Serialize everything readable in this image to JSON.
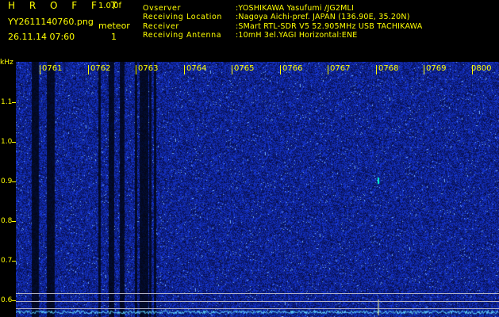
{
  "header": {
    "app_title": "H R O F F T",
    "version": "1.0.0f",
    "filename": "YY2611140760.png",
    "mode": "meteor",
    "timestamp": "26.11.14 07:60",
    "count": "1"
  },
  "info": [
    {
      "label": "Ovserver",
      "value": ":YOSHIKAWA Yasufumi /JG2MLI"
    },
    {
      "label": "Receiving Location",
      "value": ":Nagoya Aichi-pref. JAPAN (136.90E, 35.20N)"
    },
    {
      "label": "Receiver",
      "value": ":SMart RTL-SDR V5 52.905MHz USB TACHIKAWA"
    },
    {
      "label": "Receiving Antenna",
      "value": ":10mH 3el.YAGI Horizontal:ENE"
    }
  ],
  "axes": {
    "y_unit": "kHz",
    "y_ticks": [
      "1.1",
      "1.0",
      "0.9",
      "0.8",
      "0.7",
      "0.6"
    ],
    "x_ticks": [
      "0761",
      "0762",
      "0763",
      "0764",
      "0765",
      "0766",
      "0767",
      "0768",
      "0769",
      "0800"
    ]
  },
  "colors": {
    "text": "#ffff00",
    "background": "#000000",
    "noise": "#1a22c0",
    "signal": "#00e5ff",
    "gridline": "#b8b8c8"
  }
}
